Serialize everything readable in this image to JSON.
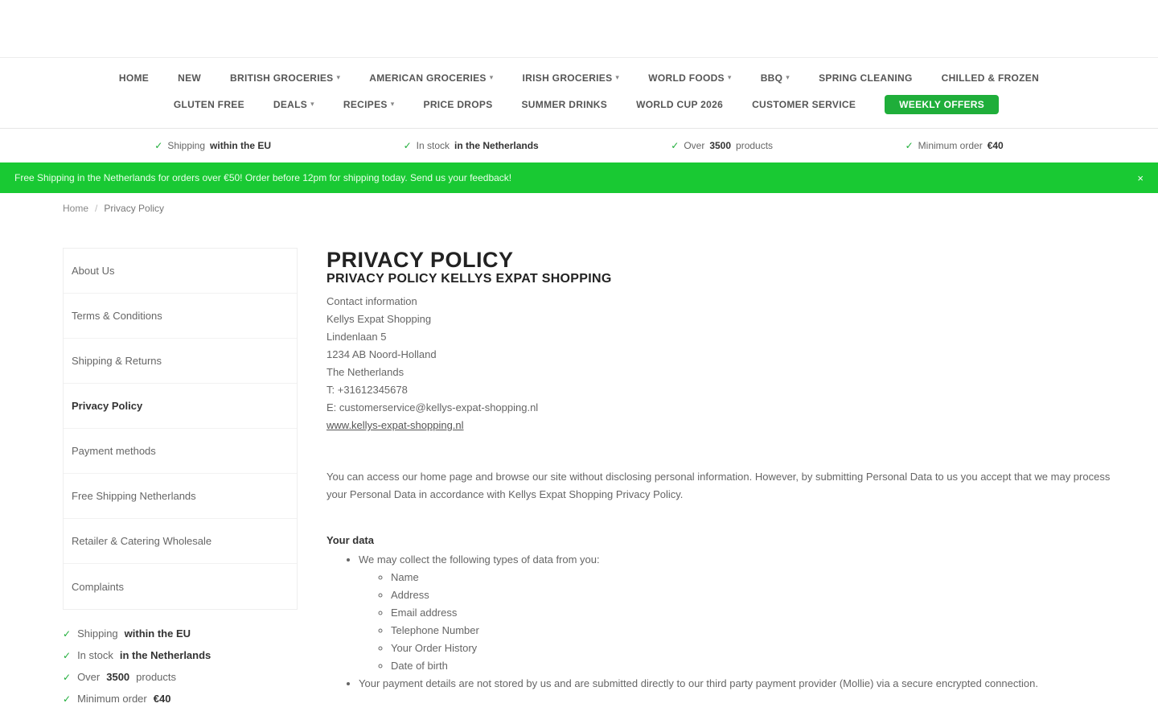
{
  "nav": {
    "row1": [
      {
        "label": "HOME",
        "chevron": false
      },
      {
        "label": "NEW",
        "chevron": false
      },
      {
        "label": "BRITISH GROCERIES",
        "chevron": true
      },
      {
        "label": "AMERICAN GROCERIES",
        "chevron": true
      },
      {
        "label": "IRISH GROCERIES",
        "chevron": true
      },
      {
        "label": "WORLD FOODS",
        "chevron": true
      },
      {
        "label": "BBQ",
        "chevron": true
      },
      {
        "label": "SPRING CLEANING",
        "chevron": false
      },
      {
        "label": "CHILLED & FROZEN",
        "chevron": false
      }
    ],
    "row2": [
      {
        "label": "GLUTEN FREE",
        "chevron": false
      },
      {
        "label": "DEALS",
        "chevron": true
      },
      {
        "label": "RECIPES",
        "chevron": true
      },
      {
        "label": "PRICE DROPS",
        "chevron": false
      },
      {
        "label": "SUMMER DRINKS",
        "chevron": false
      },
      {
        "label": "WORLD CUP 2026",
        "chevron": false
      },
      {
        "label": "CUSTOMER SERVICE",
        "chevron": false
      }
    ],
    "cta": "WEEKLY OFFERS"
  },
  "usps": [
    {
      "prefix": "Shipping",
      "bold": "within the EU"
    },
    {
      "prefix": "In stock",
      "bold": "in the Netherlands"
    },
    {
      "prefix": "Over",
      "bold": "3500",
      "suffix": "products"
    },
    {
      "prefix": "Minimum order",
      "bold": "€40"
    }
  ],
  "promo": {
    "text": "Free Shipping in the Netherlands for orders over €50! Order before 12pm for shipping today. Send us your feedback!",
    "close": "×"
  },
  "breadcrumb": {
    "home": "Home",
    "separator": "/",
    "current": "Privacy Policy"
  },
  "sidebar": {
    "items": [
      {
        "label": "About Us",
        "active": false
      },
      {
        "label": "Terms & Conditions",
        "active": false
      },
      {
        "label": "Shipping & Returns",
        "active": false
      },
      {
        "label": "Privacy Policy",
        "active": true
      },
      {
        "label": "Payment methods",
        "active": false
      },
      {
        "label": "Free Shipping Netherlands",
        "active": false
      },
      {
        "label": "Retailer & Catering Wholesale",
        "active": false
      },
      {
        "label": "Complaints",
        "active": false
      }
    ]
  },
  "content": {
    "title": "PRIVACY POLICY",
    "subtitle": "PRIVACY POLICY KELLYS EXPAT SHOPPING",
    "address": [
      "Contact information",
      "Kellys Expat Shopping",
      "Lindenlaan 5",
      "1234 AB Noord-Holland",
      "The Netherlands",
      "T: +31612345678",
      "E: customerservice@kellys-expat-shopping.nl"
    ],
    "website": "www.kellys-expat-shopping.nl",
    "intro": "You can access our home page and browse our site without disclosing personal information. However, by submitting Personal Data to us you accept that we may process your Personal Data in accordance with Kellys Expat Shopping Privacy Policy.",
    "section_title": "Your data",
    "list": [
      {
        "text": "We may collect the following types of data from you:",
        "sub": [
          "Name",
          "Address",
          "Email address",
          "Telephone Number",
          "Your Order History",
          "Date of birth"
        ]
      },
      {
        "text": "Your payment details are not stored by us and are submitted directly to our third party payment provider (Mollie) via a secure encrypted connection.",
        "sub": []
      }
    ]
  }
}
